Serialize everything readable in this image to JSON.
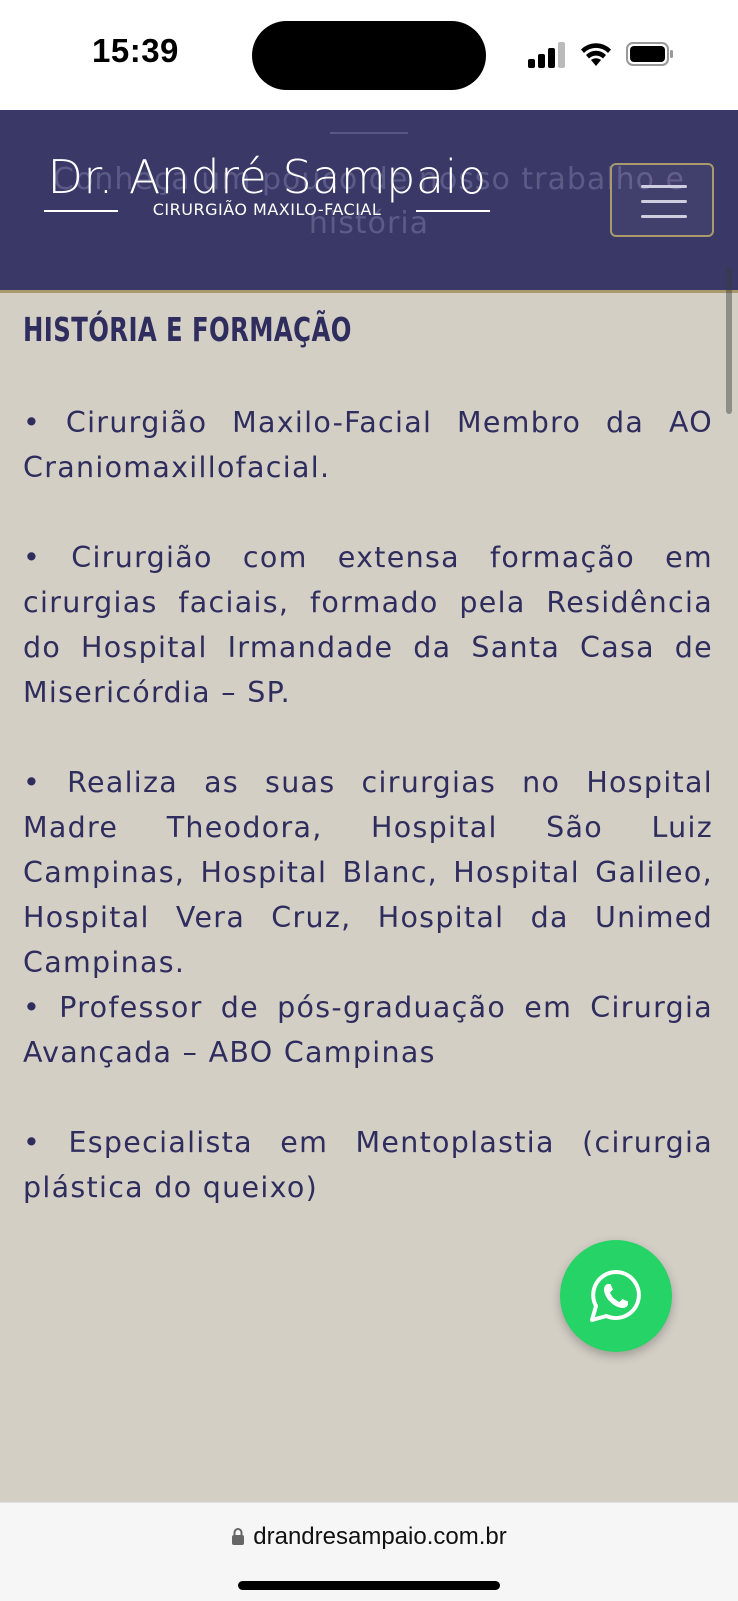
{
  "status_bar": {
    "time": "15:39"
  },
  "header": {
    "logo_name": "Dr. André Sampaio",
    "logo_tagline": "CIRURGIÃO MAXILO-FACIAL",
    "ghost_text": "Conheça um pouco de nosso trabalho e história"
  },
  "section": {
    "title": "HISTÓRIA E FORMAÇÃO",
    "bullets": [
      "• Cirurgião Maxilo-Facial Membro da AO Craniomaxillofacial.",
      "• Cirurgião com extensa formação em cirurgias faciais, formado pela Residência do Hospital Irmandade da Santa Casa de Misericórdia – SP.",
      "• Realiza as suas cirurgias no Hospital Madre Theodora, Hospital São Luiz Campinas, Hospital Blanc, Hospital Galileo, Hospital Vera Cruz, Hospital da Unimed Campinas.",
      "• Professor de pós-graduação em Cirurgia Avançada – ABO Campinas",
      "• Especialista em Mentoplastia (cirurgia plástica do queixo)"
    ]
  },
  "browser": {
    "url": "drandresampaio.com.br"
  },
  "colors": {
    "header_bg": "#3a3866",
    "page_bg": "#d3cfc5",
    "text": "#2f2d5e",
    "accent_gold": "#a89a6c",
    "whatsapp": "#25d366"
  },
  "icons": [
    "signal-icon",
    "wifi-icon",
    "battery-icon",
    "menu-icon",
    "whatsapp-icon",
    "lock-icon"
  ]
}
